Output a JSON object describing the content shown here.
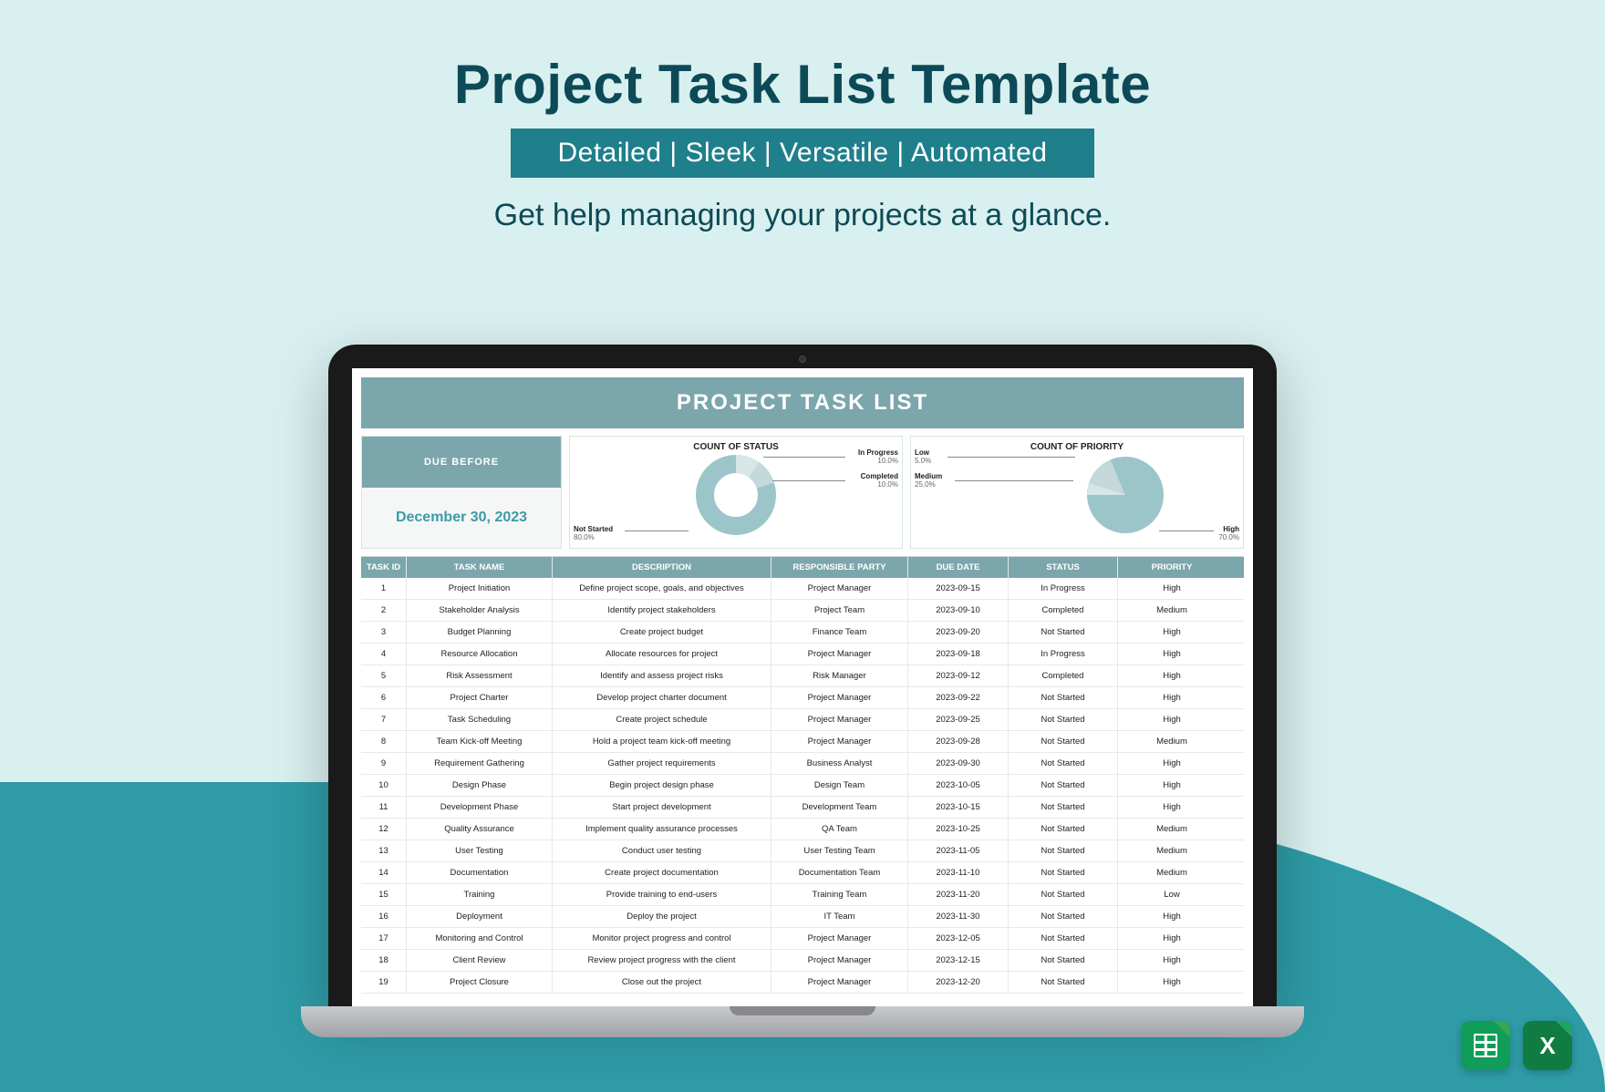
{
  "hero": {
    "title": "Project Task List Template",
    "badge": "Detailed | Sleek | Versatile | Automated",
    "subtitle": "Get help managing your projects at a glance."
  },
  "sheet": {
    "title": "PROJECT TASK LIST",
    "due_before_label": "DUE BEFORE",
    "due_before_date": "December 30, 2023"
  },
  "chart_data": [
    {
      "type": "pie",
      "title": "COUNT OF STATUS",
      "series": [
        {
          "name": "Not Started",
          "value": 80.0
        },
        {
          "name": "In Progress",
          "value": 10.0
        },
        {
          "name": "Completed",
          "value": 10.0
        }
      ],
      "labels": {
        "not_started": "Not Started",
        "not_started_pct": "80.0%",
        "in_progress": "In Progress",
        "in_progress_pct": "10.0%",
        "completed": "Completed",
        "completed_pct": "10.0%"
      }
    },
    {
      "type": "pie",
      "title": "COUNT OF PRIORITY",
      "series": [
        {
          "name": "High",
          "value": 70.0
        },
        {
          "name": "Medium",
          "value": 25.0
        },
        {
          "name": "Low",
          "value": 5.0
        }
      ],
      "labels": {
        "high": "High",
        "high_pct": "70.0%",
        "medium": "Medium",
        "medium_pct": "25.0%",
        "low": "Low",
        "low_pct": "5.0%"
      }
    }
  ],
  "table": {
    "headers": {
      "id": "TASK ID",
      "name": "TASK NAME",
      "desc": "DESCRIPTION",
      "resp": "RESPONSIBLE PARTY",
      "due": "DUE DATE",
      "status": "STATUS",
      "priority": "PRIORITY"
    },
    "rows": [
      {
        "id": "1",
        "name": "Project Initiation",
        "desc": "Define project scope, goals, and objectives",
        "resp": "Project Manager",
        "due": "2023-09-15",
        "status": "In Progress",
        "priority": "High"
      },
      {
        "id": "2",
        "name": "Stakeholder Analysis",
        "desc": "Identify project stakeholders",
        "resp": "Project Team",
        "due": "2023-09-10",
        "status": "Completed",
        "priority": "Medium"
      },
      {
        "id": "3",
        "name": "Budget Planning",
        "desc": "Create project budget",
        "resp": "Finance Team",
        "due": "2023-09-20",
        "status": "Not Started",
        "priority": "High"
      },
      {
        "id": "4",
        "name": "Resource Allocation",
        "desc": "Allocate resources for project",
        "resp": "Project Manager",
        "due": "2023-09-18",
        "status": "In Progress",
        "priority": "High"
      },
      {
        "id": "5",
        "name": "Risk Assessment",
        "desc": "Identify and assess project risks",
        "resp": "Risk Manager",
        "due": "2023-09-12",
        "status": "Completed",
        "priority": "High"
      },
      {
        "id": "6",
        "name": "Project Charter",
        "desc": "Develop project charter document",
        "resp": "Project Manager",
        "due": "2023-09-22",
        "status": "Not Started",
        "priority": "High"
      },
      {
        "id": "7",
        "name": "Task Scheduling",
        "desc": "Create project schedule",
        "resp": "Project Manager",
        "due": "2023-09-25",
        "status": "Not Started",
        "priority": "High"
      },
      {
        "id": "8",
        "name": "Team Kick-off Meeting",
        "desc": "Hold a project team kick-off meeting",
        "resp": "Project Manager",
        "due": "2023-09-28",
        "status": "Not Started",
        "priority": "Medium"
      },
      {
        "id": "9",
        "name": "Requirement Gathering",
        "desc": "Gather project requirements",
        "resp": "Business Analyst",
        "due": "2023-09-30",
        "status": "Not Started",
        "priority": "High"
      },
      {
        "id": "10",
        "name": "Design Phase",
        "desc": "Begin project design phase",
        "resp": "Design Team",
        "due": "2023-10-05",
        "status": "Not Started",
        "priority": "High"
      },
      {
        "id": "11",
        "name": "Development Phase",
        "desc": "Start project development",
        "resp": "Development Team",
        "due": "2023-10-15",
        "status": "Not Started",
        "priority": "High"
      },
      {
        "id": "12",
        "name": "Quality Assurance",
        "desc": "Implement quality assurance processes",
        "resp": "QA Team",
        "due": "2023-10-25",
        "status": "Not Started",
        "priority": "Medium"
      },
      {
        "id": "13",
        "name": "User Testing",
        "desc": "Conduct user testing",
        "resp": "User Testing Team",
        "due": "2023-11-05",
        "status": "Not Started",
        "priority": "Medium"
      },
      {
        "id": "14",
        "name": "Documentation",
        "desc": "Create project documentation",
        "resp": "Documentation Team",
        "due": "2023-11-10",
        "status": "Not Started",
        "priority": "Medium"
      },
      {
        "id": "15",
        "name": "Training",
        "desc": "Provide training to end-users",
        "resp": "Training Team",
        "due": "2023-11-20",
        "status": "Not Started",
        "priority": "Low"
      },
      {
        "id": "16",
        "name": "Deployment",
        "desc": "Deploy the project",
        "resp": "IT Team",
        "due": "2023-11-30",
        "status": "Not Started",
        "priority": "High"
      },
      {
        "id": "17",
        "name": "Monitoring and Control",
        "desc": "Monitor project progress and control",
        "resp": "Project Manager",
        "due": "2023-12-05",
        "status": "Not Started",
        "priority": "High"
      },
      {
        "id": "18",
        "name": "Client Review",
        "desc": "Review project progress with the client",
        "resp": "Project Manager",
        "due": "2023-12-15",
        "status": "Not Started",
        "priority": "High"
      },
      {
        "id": "19",
        "name": "Project Closure",
        "desc": "Close out the project",
        "resp": "Project Manager",
        "due": "2023-12-20",
        "status": "Not Started",
        "priority": "High"
      }
    ]
  },
  "icons": {
    "sheets": "google-sheets-icon",
    "excel": "excel-icon"
  }
}
